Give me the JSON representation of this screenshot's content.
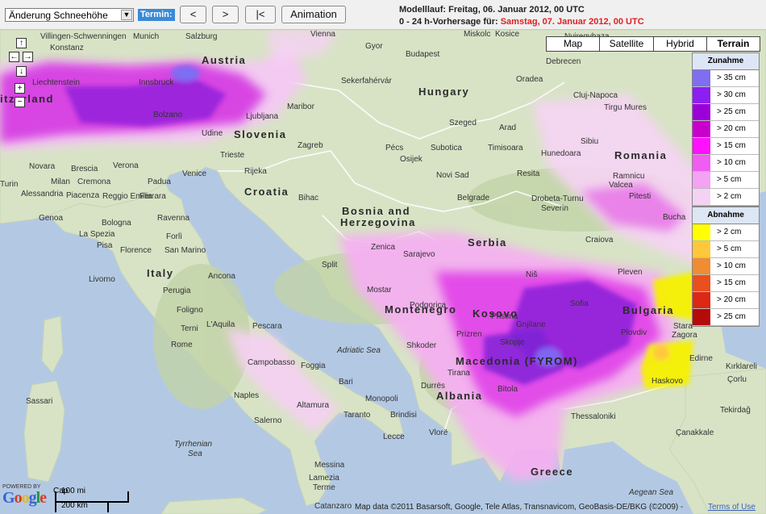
{
  "toolbar": {
    "layer_select": "Änderung Schneehöhe",
    "termin_label": "Termin:",
    "prev": "<",
    "next": ">",
    "first": "|<",
    "animation": "Animation"
  },
  "model": {
    "run_label": "Modelllauf: Freitag, 06. Januar 2012, 00 UTC",
    "forecast_label": "0 - 24 h-Vorhersage für: ",
    "forecast_date": "Samstag, 07. Januar 2012, 00 UTC"
  },
  "map_types": [
    "Map",
    "Satellite",
    "Hybrid",
    "Terrain"
  ],
  "legend": {
    "increase_title": "Zunahme",
    "increase": [
      {
        "label": "> 35 cm",
        "color": "#7f6df2"
      },
      {
        "label": "> 30 cm",
        "color": "#8c1ef2"
      },
      {
        "label": "> 25 cm",
        "color": "#9a00d8"
      },
      {
        "label": "> 20 cm",
        "color": "#c800cc"
      },
      {
        "label": "> 15 cm",
        "color": "#ff10ff"
      },
      {
        "label": "> 10 cm",
        "color": "#f05df0"
      },
      {
        "label": "> 5 cm",
        "color": "#f4a2f4"
      },
      {
        "label": "> 2 cm",
        "color": "#f4d2f4"
      }
    ],
    "decrease_title": "Abnahme",
    "decrease": [
      {
        "label": "> 2 cm",
        "color": "#ffff00"
      },
      {
        "label": "> 5 cm",
        "color": "#ffc83c"
      },
      {
        "label": "> 10 cm",
        "color": "#f08c32"
      },
      {
        "label": "> 15 cm",
        "color": "#e8501e"
      },
      {
        "label": "> 20 cm",
        "color": "#dc2814"
      },
      {
        "label": "> 25 cm",
        "color": "#b40a0a"
      }
    ]
  },
  "countries": [
    "Austria",
    "Slovenia",
    "Croatia",
    "Hungary",
    "Romania",
    "Bosnia and",
    "Herzegovina",
    "Serbia",
    "Italy",
    "Montenegro",
    "Kosovo",
    "Bulgaria",
    "Macedonia (FYROM)",
    "Albania",
    "Greece",
    "itzerland"
  ],
  "seas": [
    "Adriatic Sea",
    "Tyrrhenian",
    "Sea",
    "Aegean Sea"
  ],
  "cities": [
    "Munich",
    "Salzburg",
    "Vienna",
    "Gyor",
    "Budapest",
    "Miskolc",
    "Villingen-Schwenningen",
    "Konstanz",
    "Liechtenstein",
    "Innsbruck",
    "Bolzano",
    "Udine",
    "Trieste",
    "Ljubljana",
    "Maribor",
    "Zagreb",
    "Rijeka",
    "Pécs",
    "Osijek",
    "Subotica",
    "Szeged",
    "Arad",
    "Timisoara",
    "Oradea",
    "Debrecen",
    "Cluj-Napoca",
    "Tirgu Mures",
    "Novara",
    "Brescia",
    "Verona",
    "Padua",
    "Venice",
    "Milan",
    "Cremona",
    "Turin",
    "Alessandria",
    "Piacenza",
    "Reggio Emilia",
    "Ferrara",
    "Genoa",
    "Bologna",
    "Ravenna",
    "La Spezia",
    "Forlì",
    "Pisa",
    "Florence",
    "San Marino",
    "Livorno",
    "Ancona",
    "Perugia",
    "Foligno",
    "Terni",
    "L'Aquila",
    "Pescara",
    "Rome",
    "Campobasso",
    "Foggia",
    "Bari",
    "Naples",
    "Salerno",
    "Altamura",
    "Monopoli",
    "Taranto",
    "Brindisi",
    "Lecce",
    "Sassari",
    "Catanzaro",
    "Messina",
    "Lamezia",
    "Terme",
    "Bihac",
    "Split",
    "Sarajevo",
    "Mostar",
    "Podgorica",
    "Shkoder",
    "Tirana",
    "Durrës",
    "Prizren",
    "Pristina",
    "Gnjilane",
    "Skopje",
    "Bitola",
    "Vlorë",
    "Thessaloniki",
    "Zenica",
    "Novi Sad",
    "Belgrade",
    "Niš",
    "Sofia",
    "Plovdiv",
    "Pleven",
    "Craiova",
    "Drobeta-Turnu",
    "Severin",
    "Pitesti",
    "Valcea",
    "Ramnicu",
    "Sibiu",
    "Hunedoara",
    "Resita",
    "Bucha",
    "Stara",
    "Zagora",
    "Haskovo",
    "Edirne",
    "Kırklareli",
    "Tekirdağ",
    "Çorlu",
    "Çanakkale",
    "Sekerfahérvár",
    "Kosice",
    "Nyiregyhaza",
    "Zenica"
  ],
  "footer": {
    "powered": "POWERED BY",
    "scale_mi": "100 mi",
    "scale_km": "200 km",
    "city_cap": "Cap",
    "copyright": "Map data ©2011 Basarsoft, Google, Tele Atlas, Transnavicom, GeoBasis-DE/BKG (©2009) -",
    "terms": "Terms of Use"
  }
}
